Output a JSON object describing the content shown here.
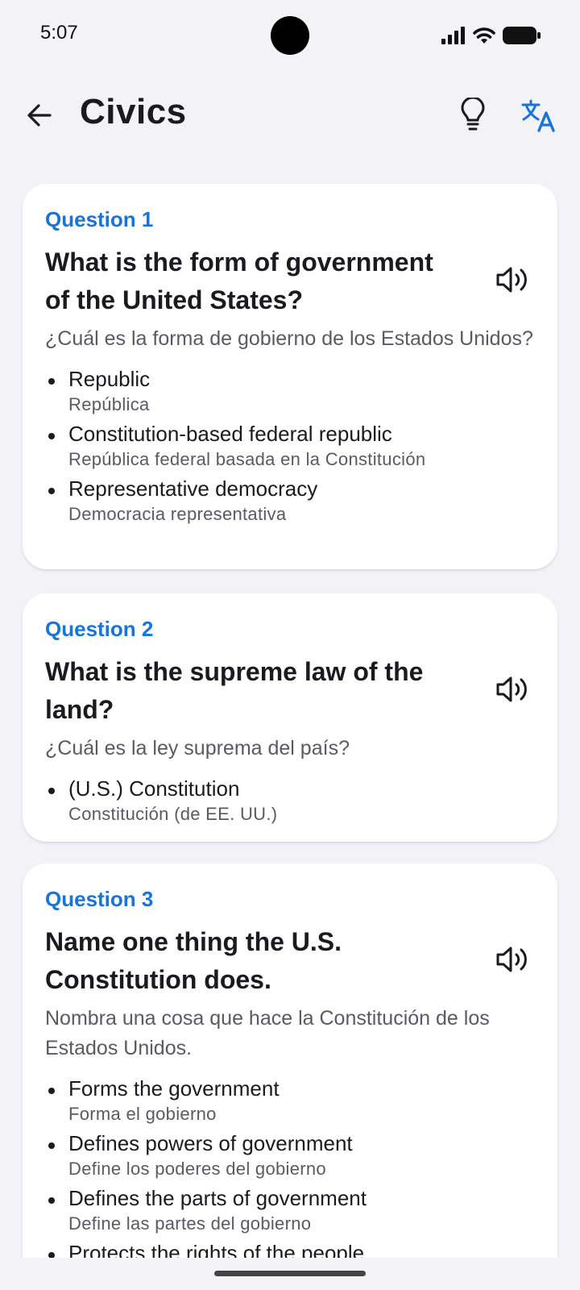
{
  "status_bar": {
    "time": "5:07"
  },
  "app_bar": {
    "title": "Civics",
    "back_icon": "arrow-left-icon",
    "hint_icon": "lightbulb-icon",
    "translate_icon": "translate-icon"
  },
  "colors": {
    "accent": "#1a73d9",
    "background": "#f2f2f7",
    "card": "#ffffff",
    "text_primary": "#1a1a1f",
    "text_secondary": "#5a5a62"
  },
  "questions": [
    {
      "number": "Question 1",
      "text_en": "What is the form of government of the United States?",
      "text_es": "¿Cuál es la forma de gobierno de los Estados Unidos?",
      "answers": [
        {
          "en": "Republic",
          "es": "República"
        },
        {
          "en": "Constitution-based federal republic",
          "es": "República federal basada en la Constitución"
        },
        {
          "en": "Representative democracy",
          "es": "Democracia representativa"
        }
      ]
    },
    {
      "number": "Question 2",
      "text_en": "What is the supreme law of the land?",
      "text_es": "¿Cuál es la ley suprema del país?",
      "answers": [
        {
          "en": "(U.S.) Constitution",
          "es": "Constitución (de EE. UU.)"
        }
      ]
    },
    {
      "number": "Question 3",
      "text_en": "Name one thing the U.S. Constitution does.",
      "text_es": "Nombra una cosa que hace la Constitución de los Estados Unidos.",
      "answers": [
        {
          "en": "Forms the government",
          "es": "Forma el gobierno"
        },
        {
          "en": "Defines powers of government",
          "es": "Define los poderes del gobierno"
        },
        {
          "en": "Defines the parts of government",
          "es": "Define las partes del gobierno"
        },
        {
          "en": "Protects the rights of the people",
          "es": ""
        }
      ]
    }
  ]
}
